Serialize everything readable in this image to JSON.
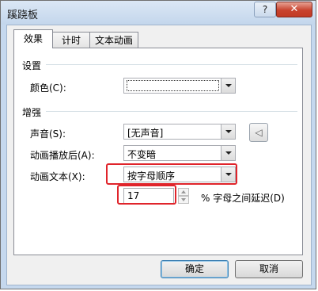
{
  "window": {
    "title": "蹊跷板",
    "help_label": "?",
    "close_label": "✕"
  },
  "tabs": [
    {
      "label": "效果",
      "active": true
    },
    {
      "label": "计时",
      "active": false
    },
    {
      "label": "文本动画",
      "active": false
    }
  ],
  "settings": {
    "header": "设置",
    "color_label": "颜色(C):",
    "color_value": ""
  },
  "enhance": {
    "header": "增强",
    "sound_label": "声音(S):",
    "sound_value": "[无声音]",
    "after_anim_label": "动画播放后(A):",
    "after_anim_value": "不变暗",
    "anim_text_label": "动画文本(X):",
    "anim_text_value": "按字母顺序",
    "delay_value": "17",
    "delay_label": "% 字母之间延迟(D)"
  },
  "buttons": {
    "ok": "确定",
    "cancel": "取消"
  },
  "colors": {
    "highlight": "#e0242b",
    "window_frame": "#c5d8ee",
    "close": "#c8432f"
  }
}
